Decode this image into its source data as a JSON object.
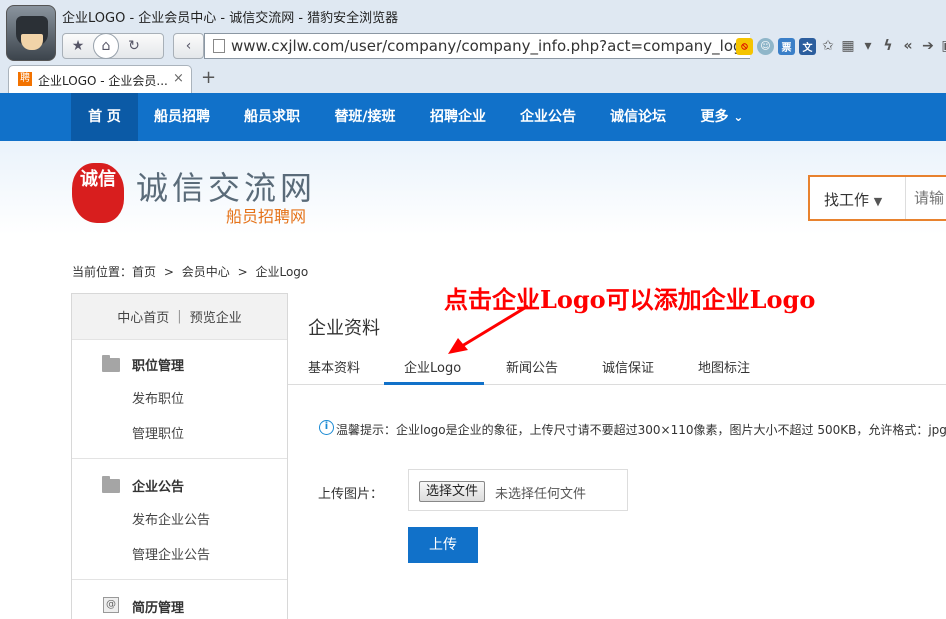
{
  "browser": {
    "window_title": "企业LOGO - 企业会员中心 - 诚信交流网 - 猎豹安全浏览器",
    "url": "www.cxjlw.com/user/company/company_info.php?act=company_logo",
    "tab_title": "企业LOGO - 企业会员...",
    "tab_favicon_text": "聘",
    "new_tab_symbol": "+",
    "close_symbol": "×"
  },
  "nav": {
    "items": [
      "首 页",
      "船员招聘",
      "船员求职",
      "替班/接班",
      "招聘企业",
      "企业公告",
      "诚信论坛",
      "更多"
    ],
    "active_index": 0,
    "more_chevron": "⌄"
  },
  "header": {
    "seal_text": "诚信",
    "brand_main": "诚信交流网",
    "brand_sub": "船员招聘网",
    "search_type": "找工作",
    "search_placeholder": "请输"
  },
  "breadcrumb": {
    "items": [
      "当前位置：首页",
      ">",
      "会员中心",
      ">",
      "企业Logo"
    ]
  },
  "sidebar": {
    "top_links": [
      "中心首页",
      "预览企业"
    ],
    "top_sep": "|",
    "groups": [
      {
        "title": "职位管理",
        "links": [
          "发布职位",
          "管理职位"
        ]
      },
      {
        "title": "企业公告",
        "links": [
          "发布企业公告",
          "管理企业公告"
        ]
      },
      {
        "title": "简历管理",
        "links": []
      }
    ]
  },
  "main": {
    "title": "企业资料",
    "tabs": [
      "基本资料",
      "企业Logo",
      "新闻公告",
      "诚信保证",
      "地图标注"
    ],
    "active_tab": 1,
    "notice": "温馨提示：企业logo是企业的象征，上传尺寸请不要超过300×110像素，图片大小不超过 500KB，允许格式：jpg/",
    "upload_label": "上传图片：",
    "file_button": "选择文件",
    "file_status": "未选择任何文件",
    "upload_button": "上传"
  },
  "annotation": {
    "text": "点击企业Logo可以添加企业Logo",
    "color": "#ff0000"
  },
  "colors": {
    "nav_blue": "#1171c9",
    "accent_orange": "#e8822e",
    "seal_red": "#d81e1e"
  }
}
